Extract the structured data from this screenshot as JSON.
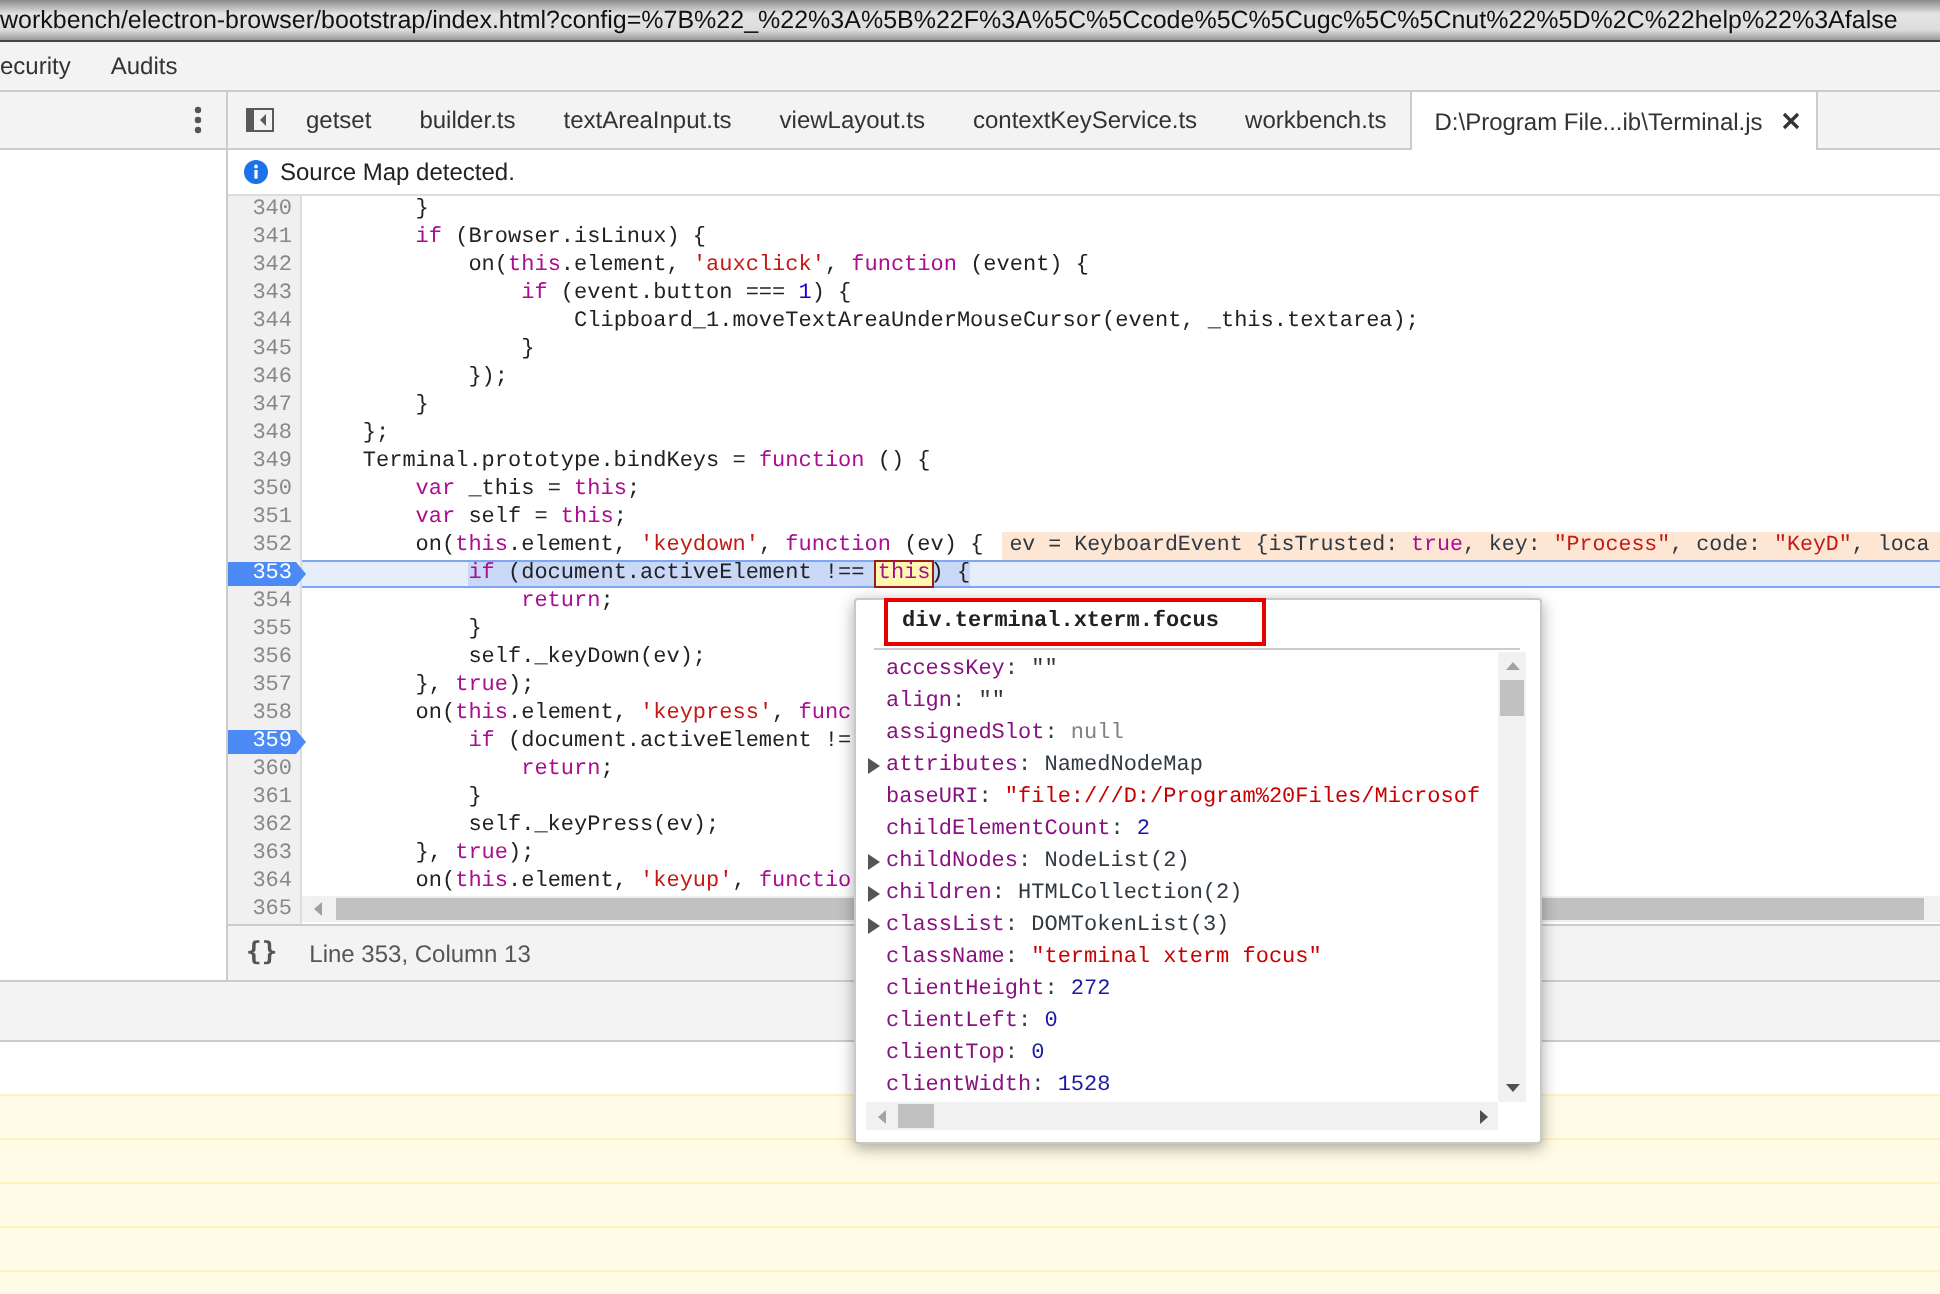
{
  "window": {
    "title": "workbench/electron-browser/bootstrap/index.html?config=%7B%22_%22%3A%5B%22F%3A%5C%5Ccode%5C%5Cugc%5C%5Cnut%22%5D%2C%22help%22%3Afalse"
  },
  "panel_tabs": [
    {
      "label": "ecurity",
      "selected": false
    },
    {
      "label": "Audits",
      "selected": false
    }
  ],
  "editor_tabs": [
    {
      "label": "getset",
      "selected": false
    },
    {
      "label": "builder.ts",
      "selected": false
    },
    {
      "label": "textAreaInput.ts",
      "selected": false
    },
    {
      "label": "viewLayout.ts",
      "selected": false
    },
    {
      "label": "contextKeyService.ts",
      "selected": false
    },
    {
      "label": "workbench.ts",
      "selected": false
    },
    {
      "label": "D:\\Program File...ib\\Terminal.js",
      "selected": true
    }
  ],
  "notice": {
    "text": "Source Map detected."
  },
  "lines": [
    {
      "number": "340",
      "breakpoint": false,
      "current": false,
      "tokens": [
        {
          "kind": "plain",
          "text": "        }"
        }
      ]
    },
    {
      "number": "341",
      "breakpoint": false,
      "current": false,
      "tokens": [
        {
          "kind": "keyword",
          "text": "        if"
        },
        {
          "kind": "plain",
          "text": " (Browser.isLinux) {"
        }
      ]
    },
    {
      "number": "342",
      "breakpoint": false,
      "current": false,
      "tokens": [
        {
          "kind": "plain",
          "text": "            on("
        },
        {
          "kind": "keyword",
          "text": "this"
        },
        {
          "kind": "plain",
          "text": ".element, "
        },
        {
          "kind": "string",
          "text": "'auxclick'"
        },
        {
          "kind": "plain",
          "text": ", "
        },
        {
          "kind": "keyword",
          "text": "function"
        },
        {
          "kind": "plain",
          "text": " (event) {"
        }
      ]
    },
    {
      "number": "343",
      "breakpoint": false,
      "current": false,
      "tokens": [
        {
          "kind": "keyword",
          "text": "                if"
        },
        {
          "kind": "plain",
          "text": " (event.button === "
        },
        {
          "kind": "number",
          "text": "1"
        },
        {
          "kind": "plain",
          "text": ") {"
        }
      ]
    },
    {
      "number": "344",
      "breakpoint": false,
      "current": false,
      "tokens": [
        {
          "kind": "plain",
          "text": "                    Clipboard_1.moveTextAreaUnderMouseCursor(event, _this.textarea);"
        }
      ]
    },
    {
      "number": "345",
      "breakpoint": false,
      "current": false,
      "tokens": [
        {
          "kind": "plain",
          "text": "                }"
        }
      ]
    },
    {
      "number": "346",
      "breakpoint": false,
      "current": false,
      "tokens": [
        {
          "kind": "plain",
          "text": "            });"
        }
      ]
    },
    {
      "number": "347",
      "breakpoint": false,
      "current": false,
      "tokens": [
        {
          "kind": "plain",
          "text": "        }"
        }
      ]
    },
    {
      "number": "348",
      "breakpoint": false,
      "current": false,
      "tokens": [
        {
          "kind": "plain",
          "text": "    };"
        }
      ]
    },
    {
      "number": "349",
      "breakpoint": false,
      "current": false,
      "tokens": [
        {
          "kind": "plain",
          "text": "    Terminal.prototype.bindKeys = "
        },
        {
          "kind": "keyword",
          "text": "function"
        },
        {
          "kind": "plain",
          "text": " () {"
        }
      ]
    },
    {
      "number": "350",
      "breakpoint": false,
      "current": false,
      "tokens": [
        {
          "kind": "keyword",
          "text": "        var"
        },
        {
          "kind": "plain",
          "text": " _this = "
        },
        {
          "kind": "keyword",
          "text": "this"
        },
        {
          "kind": "plain",
          "text": ";"
        }
      ]
    },
    {
      "number": "351",
      "breakpoint": false,
      "current": false,
      "tokens": [
        {
          "kind": "keyword",
          "text": "        var"
        },
        {
          "kind": "plain",
          "text": " self = "
        },
        {
          "kind": "keyword",
          "text": "this"
        },
        {
          "kind": "plain",
          "text": ";"
        }
      ]
    },
    {
      "number": "352",
      "breakpoint": false,
      "current": false,
      "tokens": [
        {
          "kind": "plain",
          "text": "        on("
        },
        {
          "kind": "keyword",
          "text": "this"
        },
        {
          "kind": "plain",
          "text": ".element, "
        },
        {
          "kind": "string",
          "text": "'keydown'"
        },
        {
          "kind": "plain",
          "text": ", "
        },
        {
          "kind": "keyword",
          "text": "function"
        },
        {
          "kind": "plain",
          "text": " (ev) {"
        }
      ],
      "inline_value": [
        {
          "kind": "plain",
          "text": "ev = KeyboardEvent {isTrusted: "
        },
        {
          "kind": "keyword",
          "text": "true"
        },
        {
          "kind": "plain",
          "text": ", key: "
        },
        {
          "kind": "string",
          "text": "\"Process\""
        },
        {
          "kind": "plain",
          "text": ", code: "
        },
        {
          "kind": "string",
          "text": "\"KeyD\""
        },
        {
          "kind": "plain",
          "text": ", loca"
        }
      ]
    },
    {
      "number": "353",
      "breakpoint": true,
      "current": true,
      "tokens": [
        {
          "kind": "keyword",
          "text": "            if"
        },
        {
          "kind": "plain",
          "text": " (document.activeElement !== "
        },
        {
          "kind": "hover",
          "text": "this"
        },
        {
          "kind": "plain",
          "text": ") {"
        }
      ]
    },
    {
      "number": "354",
      "breakpoint": false,
      "current": false,
      "tokens": [
        {
          "kind": "keyword",
          "text": "                return"
        },
        {
          "kind": "plain",
          "text": ";"
        }
      ]
    },
    {
      "number": "355",
      "breakpoint": false,
      "current": false,
      "tokens": [
        {
          "kind": "plain",
          "text": "            }"
        }
      ]
    },
    {
      "number": "356",
      "breakpoint": false,
      "current": false,
      "tokens": [
        {
          "kind": "plain",
          "text": "            self._keyDown(ev);"
        }
      ]
    },
    {
      "number": "357",
      "breakpoint": false,
      "current": false,
      "tokens": [
        {
          "kind": "plain",
          "text": "        }, "
        },
        {
          "kind": "keyword",
          "text": "true"
        },
        {
          "kind": "plain",
          "text": ");"
        }
      ]
    },
    {
      "number": "358",
      "breakpoint": false,
      "current": false,
      "tokens": [
        {
          "kind": "plain",
          "text": "        on("
        },
        {
          "kind": "keyword",
          "text": "this"
        },
        {
          "kind": "plain",
          "text": ".element, "
        },
        {
          "kind": "string",
          "text": "'keypress'"
        },
        {
          "kind": "plain",
          "text": ", "
        },
        {
          "kind": "keyword",
          "text": "func"
        }
      ]
    },
    {
      "number": "359",
      "breakpoint": true,
      "current": false,
      "tokens": [
        {
          "kind": "keyword",
          "text": "            if"
        },
        {
          "kind": "plain",
          "text": " (document.activeElement !="
        }
      ]
    },
    {
      "number": "360",
      "breakpoint": false,
      "current": false,
      "tokens": [
        {
          "kind": "keyword",
          "text": "                return"
        },
        {
          "kind": "plain",
          "text": ";"
        }
      ]
    },
    {
      "number": "361",
      "breakpoint": false,
      "current": false,
      "tokens": [
        {
          "kind": "plain",
          "text": "            }"
        }
      ]
    },
    {
      "number": "362",
      "breakpoint": false,
      "current": false,
      "tokens": [
        {
          "kind": "plain",
          "text": "            self._keyPress(ev);"
        }
      ]
    },
    {
      "number": "363",
      "breakpoint": false,
      "current": false,
      "tokens": [
        {
          "kind": "plain",
          "text": "        }, "
        },
        {
          "kind": "keyword",
          "text": "true"
        },
        {
          "kind": "plain",
          "text": ");"
        }
      ]
    },
    {
      "number": "364",
      "breakpoint": false,
      "current": false,
      "tokens": [
        {
          "kind": "plain",
          "text": "        on("
        },
        {
          "kind": "keyword",
          "text": "this"
        },
        {
          "kind": "plain",
          "text": ".element, "
        },
        {
          "kind": "string",
          "text": "'keyup'"
        },
        {
          "kind": "plain",
          "text": ", "
        },
        {
          "kind": "keyword",
          "text": "functio"
        }
      ]
    },
    {
      "number": "365",
      "breakpoint": false,
      "current": false
    }
  ],
  "status_bar": {
    "pretty_print": "{}",
    "position": "Line 353, Column 13"
  },
  "popup": {
    "title": "div.terminal.xterm.focus",
    "properties": [
      {
        "expandable": false,
        "tokens": [
          {
            "kind": "name",
            "text": "accessKey"
          },
          {
            "kind": "plain",
            "text": ": "
          },
          {
            "kind": "empty",
            "text": "\"\""
          }
        ]
      },
      {
        "expandable": false,
        "tokens": [
          {
            "kind": "name",
            "text": "align"
          },
          {
            "kind": "plain",
            "text": ": "
          },
          {
            "kind": "empty",
            "text": "\"\""
          }
        ]
      },
      {
        "expandable": false,
        "tokens": [
          {
            "kind": "name",
            "text": "assignedSlot"
          },
          {
            "kind": "plain",
            "text": ": "
          },
          {
            "kind": "null",
            "text": "null"
          }
        ]
      },
      {
        "expandable": true,
        "tokens": [
          {
            "kind": "name",
            "text": "attributes"
          },
          {
            "kind": "plain",
            "text": ": "
          },
          {
            "kind": "object",
            "text": "NamedNodeMap"
          }
        ]
      },
      {
        "expandable": false,
        "tokens": [
          {
            "kind": "name",
            "text": "baseURI"
          },
          {
            "kind": "plain",
            "text": ": "
          },
          {
            "kind": "string",
            "text": "\"file:///D:/Program%20Files/Microsof"
          }
        ]
      },
      {
        "expandable": false,
        "tokens": [
          {
            "kind": "name",
            "text": "childElementCount"
          },
          {
            "kind": "plain",
            "text": ": "
          },
          {
            "kind": "number",
            "text": "2"
          }
        ]
      },
      {
        "expandable": true,
        "tokens": [
          {
            "kind": "name",
            "text": "childNodes"
          },
          {
            "kind": "plain",
            "text": ": "
          },
          {
            "kind": "object",
            "text": "NodeList(2)"
          }
        ]
      },
      {
        "expandable": true,
        "tokens": [
          {
            "kind": "name",
            "text": "children"
          },
          {
            "kind": "plain",
            "text": ": "
          },
          {
            "kind": "object",
            "text": "HTMLCollection(2)"
          }
        ]
      },
      {
        "expandable": true,
        "tokens": [
          {
            "kind": "name",
            "text": "classList"
          },
          {
            "kind": "plain",
            "text": ": "
          },
          {
            "kind": "object",
            "text": "DOMTokenList(3)"
          }
        ]
      },
      {
        "expandable": false,
        "tokens": [
          {
            "kind": "name",
            "text": "className"
          },
          {
            "kind": "plain",
            "text": ": "
          },
          {
            "kind": "string",
            "text": "\"terminal xterm focus\""
          }
        ]
      },
      {
        "expandable": false,
        "tokens": [
          {
            "kind": "name",
            "text": "clientHeight"
          },
          {
            "kind": "plain",
            "text": ": "
          },
          {
            "kind": "number",
            "text": "272"
          }
        ]
      },
      {
        "expandable": false,
        "tokens": [
          {
            "kind": "name",
            "text": "clientLeft"
          },
          {
            "kind": "plain",
            "text": ": "
          },
          {
            "kind": "number",
            "text": "0"
          }
        ]
      },
      {
        "expandable": false,
        "tokens": [
          {
            "kind": "name",
            "text": "clientTop"
          },
          {
            "kind": "plain",
            "text": ": "
          },
          {
            "kind": "number",
            "text": "0"
          }
        ]
      },
      {
        "expandable": false,
        "tokens": [
          {
            "kind": "name",
            "text": "clientWidth"
          },
          {
            "kind": "plain",
            "text": ": "
          },
          {
            "kind": "number",
            "text": "1528"
          }
        ]
      }
    ]
  }
}
